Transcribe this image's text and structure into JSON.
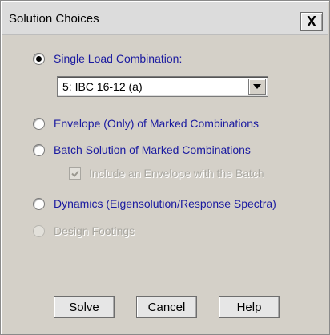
{
  "window": {
    "title": "Solution Choices",
    "close_glyph": "X"
  },
  "options": {
    "single_load": {
      "label": "Single Load Combination:",
      "selected": true,
      "disabled": false
    },
    "combination_select": {
      "value": "5: IBC 16-12 (a)"
    },
    "envelope": {
      "label": "Envelope (Only) of Marked Combinations",
      "selected": false,
      "disabled": false
    },
    "batch": {
      "label": "Batch Solution of Marked Combinations",
      "selected": false,
      "disabled": false
    },
    "include_envelope": {
      "label": "Include an Envelope with the Batch",
      "checked": true,
      "disabled": true
    },
    "dynamics": {
      "label": "Dynamics (Eigensolution/Response Spectra)",
      "selected": false,
      "disabled": false
    },
    "design_footings": {
      "label": "Design Footings",
      "selected": false,
      "disabled": true
    }
  },
  "buttons": {
    "solve": "Solve",
    "cancel": "Cancel",
    "help": "Help"
  },
  "colors": {
    "dialog_bg": "#d4d0c8",
    "label_text": "#1a1aa0",
    "disabled_text": "#a9a7a0"
  },
  "icons": {
    "close": "close-icon",
    "dropdown": "chevron-down-icon",
    "check": "checkmark-icon"
  }
}
